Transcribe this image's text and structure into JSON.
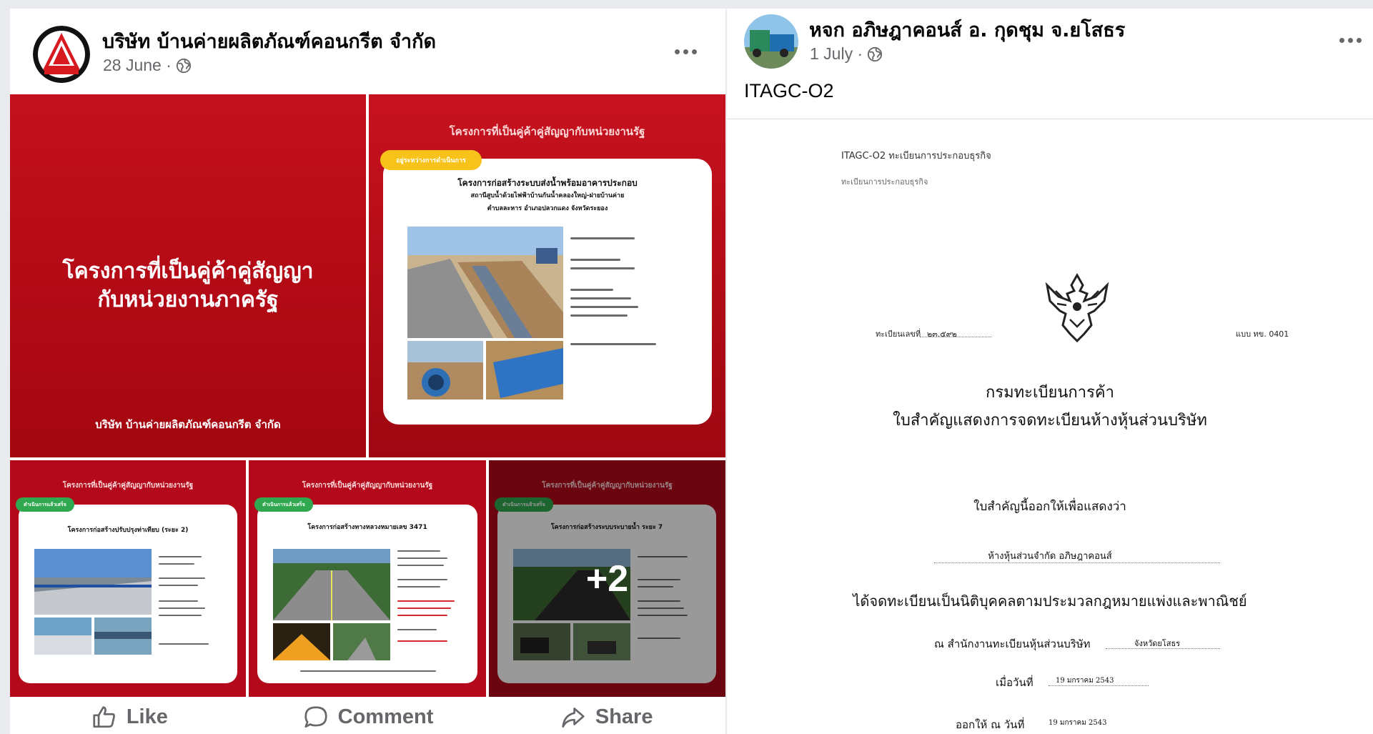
{
  "posts": [
    {
      "author": "บริษัท บ้านค่ายผลิตภัณฑ์คอนกรีต จำกัด",
      "date": "28 June ·",
      "images": {
        "cover": {
          "title_line1": "โครงการที่เป็นคู่ค้าคู่สัญญา",
          "title_line2": "กับหน่วยงานภาครัฐ",
          "company": "บริษัท บ้านค่ายผลิตภัณฑ์คอนกรีต จำกัด"
        },
        "project_top": {
          "heading": "โครงการที่เป็นคู่ค้าคู่สัญญากับหน่วยงานรัฐ",
          "badge": "อยู่ระหว่างการดำเนินการ",
          "title_line1": "โครงการก่อสร้างระบบส่งน้ำพร้อมอาคารประกอบ",
          "title_line2": "สถานีสูบน้ำด้วยไฟฟ้าบ้านกันน้ำคลองใหญ่-ฝายบ้านค่าย",
          "title_line3": "ตำบลละหาร อำเภอปลวกแดง จังหวัดระยอง"
        },
        "project_b1": {
          "heading": "โครงการที่เป็นคู่ค้าคู่สัญญากับหน่วยงานรัฐ",
          "badge": "ดำเนินการแล้วเสร็จ",
          "title": "โครงการก่อสร้างปรับปรุงท่าเทียบ (ระยะ 2)"
        },
        "project_b2": {
          "heading": "โครงการที่เป็นคู่ค้าคู่สัญญากับหน่วยงานรัฐ",
          "badge": "ดำเนินการแล้วเสร็จ",
          "title": "โครงการก่อสร้างทางหลวงหมายเลข 3471"
        },
        "project_b3": {
          "heading": "โครงการที่เป็นคู่ค้าคู่สัญญากับหน่วยงานรัฐ",
          "badge": "ดำเนินการแล้วเสร็จ",
          "title": "โครงการก่อสร้างระบบระบายน้ำ ระยะ 7"
        },
        "more_count": "+2"
      },
      "actions": {
        "like": "Like",
        "comment": "Comment",
        "share": "Share"
      }
    },
    {
      "author": "หจก อภิษฎาคอนส์ อ. กุดชุม จ.ยโสธร",
      "date": "1 July ·",
      "text": "ITAGC-O2",
      "document": {
        "header": "ITAGC-O2 ทะเบียนการประกอบธุรกิจ",
        "subheader": "ทะเบียนการประกอบธุรกิจ",
        "reg_label": "ทะเบียนเลขที่",
        "reg_number": "๒๓.๕๙๒",
        "form_code": "แบบ ทข. 0401",
        "department": "กรมทะเบียนการค้า",
        "certificate_title": "ใบสำคัญแสดงการจดทะเบียนห้างหุ้นส่วนบริษัท",
        "certify_text": "ใบสำคัญนี้ออกให้เพื่อแสดงว่า",
        "company_line": "ห้างหุ้นส่วนจำกัด อภิษฎาคอนส์",
        "registered_text": "ได้จดทะเบียนเป็นนิติบุคคลตามประมวลกฎหมายแพ่งและพาณิชย์",
        "office_line": "ณ สำนักงานทะเบียนหุ้นส่วนบริษัท",
        "office_value": "จังหวัดยโสธร",
        "date_label": "เมื่อวันที่",
        "date_value": "19 มกราคม 2543",
        "issued_label": "ออกให้ ณ วันที่",
        "issued_value": "19 มกราคม 2543"
      }
    }
  ]
}
